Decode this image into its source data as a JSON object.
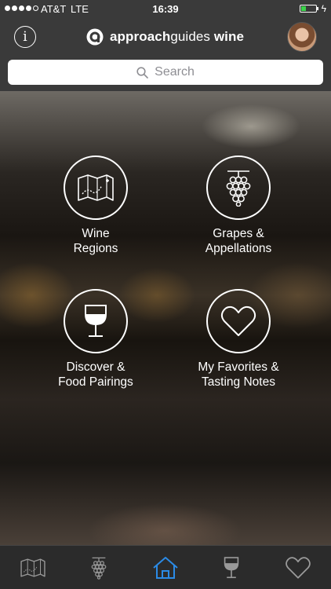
{
  "status_bar": {
    "signal_strength": 4,
    "signal_max": 5,
    "carrier": "AT&T",
    "network": "LTE",
    "time": "16:39",
    "battery_level": 0.3,
    "battery_color": "#3bd34b"
  },
  "header": {
    "info_icon": "info-icon",
    "brand": {
      "bold": "approach",
      "light": "guides",
      "suffix": "wine"
    },
    "avatar": "user-avatar"
  },
  "search": {
    "placeholder": "Search",
    "icon": "search-icon"
  },
  "menu": [
    {
      "line1": "Wine",
      "line2": "Regions",
      "icon": "map-icon"
    },
    {
      "line1": "Grapes &",
      "line2": "Appellations",
      "icon": "grapes-icon"
    },
    {
      "line1": "Discover &",
      "line2": "Food Pairings",
      "icon": "wine-glass-icon"
    },
    {
      "line1": "My Favorites &",
      "line2": "Tasting Notes",
      "icon": "heart-icon"
    }
  ],
  "tabbar": {
    "tabs": [
      {
        "icon": "map-icon",
        "active": false
      },
      {
        "icon": "grapes-icon",
        "active": false
      },
      {
        "icon": "home-icon",
        "active": true
      },
      {
        "icon": "wine-glass-icon",
        "active": false
      },
      {
        "icon": "heart-icon",
        "active": false
      }
    ],
    "active_color": "#2b8be6",
    "inactive_color": "#9a9a9a"
  }
}
